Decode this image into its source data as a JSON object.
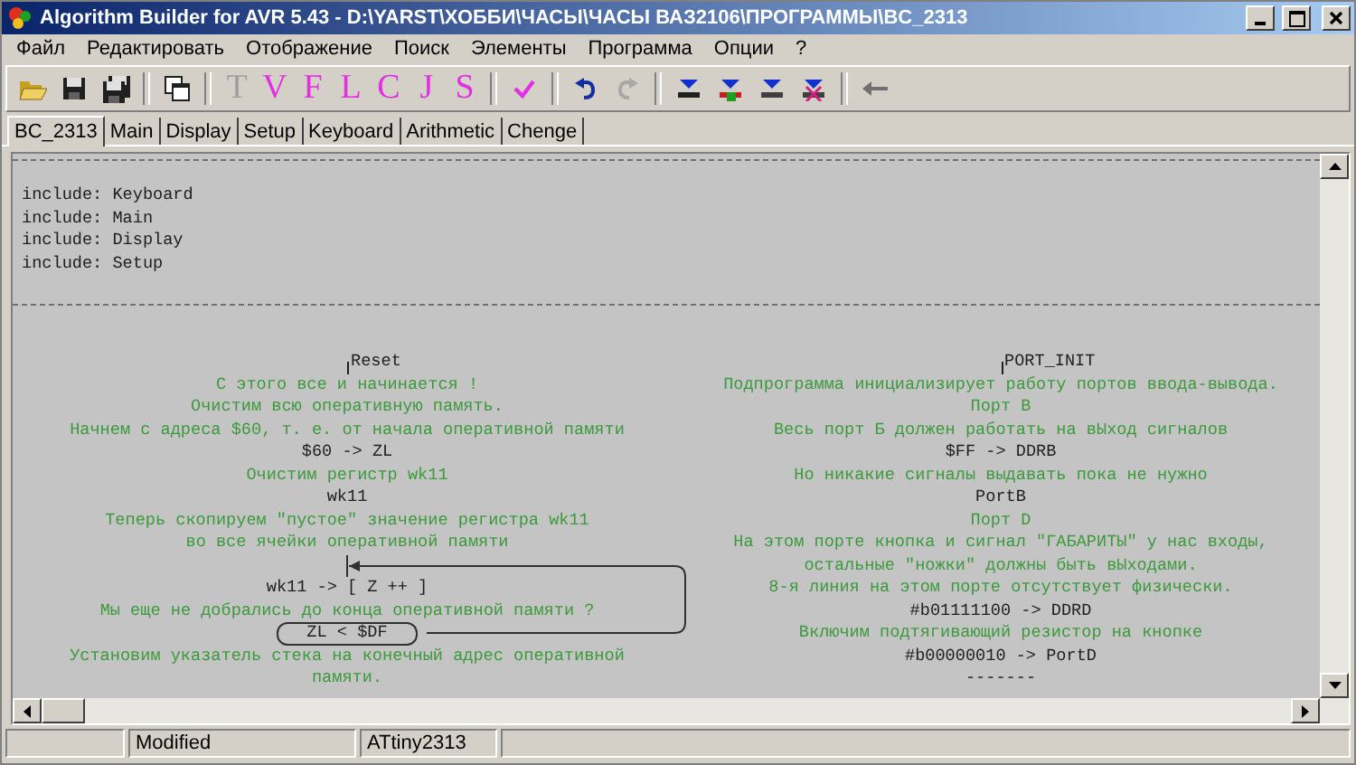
{
  "window": {
    "title": "Algorithm Builder for AVR 5.43 - D:\\YARST\\ХОББИ\\ЧАСЫ\\ЧАСЫ ВАЗ2106\\ПРОГРАММЫ\\BC_2313"
  },
  "menu": [
    "Файл",
    "Редактировать",
    "Отображение",
    "Поиск",
    "Элементы",
    "Программа",
    "Опции",
    "?"
  ],
  "toolbar": {
    "letters": [
      {
        "label": "T",
        "disabled": true
      },
      {
        "label": "V",
        "disabled": false
      },
      {
        "label": "F",
        "disabled": false
      },
      {
        "label": "L",
        "disabled": false
      },
      {
        "label": "C",
        "disabled": false
      },
      {
        "label": "J",
        "disabled": false
      },
      {
        "label": "S",
        "disabled": false
      }
    ],
    "redo": {
      "disabled": true
    }
  },
  "tabs": [
    {
      "label": "BC_2313",
      "selected": true
    },
    {
      "label": "Main",
      "selected": false
    },
    {
      "label": "Display",
      "selected": false
    },
    {
      "label": "Setup",
      "selected": false
    },
    {
      "label": "Keyboard",
      "selected": false
    },
    {
      "label": "Arithmetic",
      "selected": false
    },
    {
      "label": "Chenge",
      "selected": false
    }
  ],
  "includes": [
    "include: Keyboard",
    "include: Main",
    "include: Display",
    "include: Setup"
  ],
  "flow": [
    {
      "items": [
        {
          "kind": "label",
          "text": "Reset"
        },
        {
          "kind": "comment",
          "text": "С этого все и начинается !"
        },
        {
          "kind": "comment",
          "text": "Очистим всю оперативную память."
        },
        {
          "kind": "comment",
          "text": "Начнем с адреса $60, т. е. от начала оперативной памяти"
        },
        {
          "kind": "code",
          "text": "$60 -> ZL"
        },
        {
          "kind": "comment",
          "text": "Очистим регистр wk11"
        },
        {
          "kind": "code",
          "text": "wk11"
        },
        {
          "kind": "comment",
          "text": "Теперь скопируем \"пустое\" значение регистра wk11"
        },
        {
          "kind": "comment",
          "text": "во все ячейки оперативной памяти"
        },
        {
          "kind": "loop_start"
        },
        {
          "kind": "code",
          "text": "wk11 -> [ Z ++ ]"
        },
        {
          "kind": "comment",
          "text": "Мы еще не добрались до конца оперативной памяти ?"
        },
        {
          "kind": "condition",
          "text": "ZL < $DF"
        },
        {
          "kind": "comment",
          "text": "Установим указатель стека на конечный адрес оперативной"
        },
        {
          "kind": "comment",
          "text": "памяти."
        }
      ]
    },
    {
      "items": [
        {
          "kind": "label",
          "text": "PORT_INIT"
        },
        {
          "kind": "comment",
          "text": "Подпрограмма инициализирует работу портов ввода-вывода."
        },
        {
          "kind": "comment",
          "text": "Порт B"
        },
        {
          "kind": "comment",
          "text": "Весь порт Б должен работать на вЫход сигналов"
        },
        {
          "kind": "code",
          "text": "$FF -> DDRB"
        },
        {
          "kind": "comment",
          "text": "Но никакие сигналы выдавать пока не нужно"
        },
        {
          "kind": "code",
          "text": "PortB"
        },
        {
          "kind": "comment",
          "text": "Порт D"
        },
        {
          "kind": "comment",
          "text": "На этом порте кнопка и сигнал \"ГАБАРИТЫ\" у нас входы,"
        },
        {
          "kind": "comment",
          "text": "остальные \"ножки\" должны быть вЫходами."
        },
        {
          "kind": "comment",
          "text": "8-я линия на этом порте отсутствует физически."
        },
        {
          "kind": "code",
          "text": "#b01111100 -> DDRD"
        },
        {
          "kind": "comment",
          "text": "Включим подтягивающий резистор на кнопке"
        },
        {
          "kind": "code",
          "text": "#b00000010 -> PortD"
        },
        {
          "kind": "code",
          "text": "-------"
        }
      ]
    }
  ],
  "status_bar": {
    "state": "Modified",
    "device": "ATtiny2313"
  }
}
